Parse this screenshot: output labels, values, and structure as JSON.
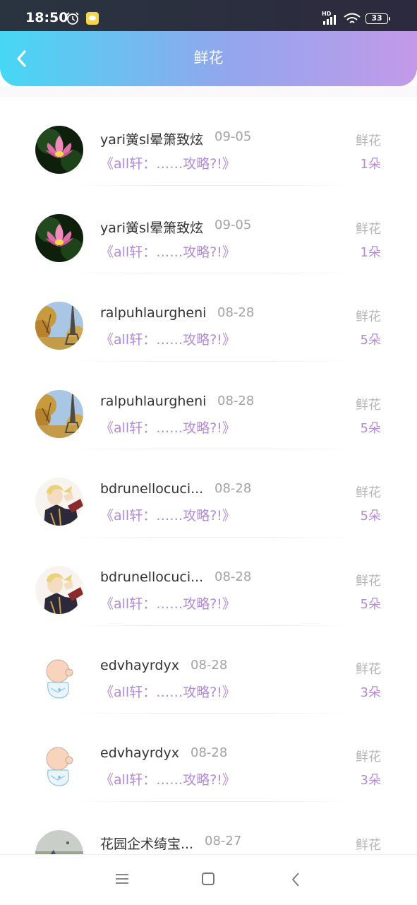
{
  "status_bar": {
    "time": "18:50",
    "hd": "HD",
    "battery": "33"
  },
  "header": {
    "title": "鲜花"
  },
  "colors": {
    "accent": "#b28ad8",
    "gradient_start": "#46d7f5",
    "gradient_end": "#c29ae9"
  },
  "rows": [
    {
      "avatar": "lotus-avatar",
      "name": "yari黉sl晕箫致炫",
      "date": "09-05",
      "subtitle": "《all轩：……攻略?!》",
      "gift_label": "鲜花",
      "gift_count": "1朵"
    },
    {
      "avatar": "lotus-avatar",
      "name": "yari黉sl晕箫致炫",
      "date": "09-05",
      "subtitle": "《all轩：……攻略?!》",
      "gift_label": "鲜花",
      "gift_count": "1朵"
    },
    {
      "avatar": "eiffel-avatar",
      "name": "ralpuhlaurgheni",
      "date": "08-28",
      "subtitle": "《all轩：……攻略?!》",
      "gift_label": "鲜花",
      "gift_count": "5朵"
    },
    {
      "avatar": "eiffel-avatar",
      "name": "ralpuhlaurgheni",
      "date": "08-28",
      "subtitle": "《all轩：……攻略?!》",
      "gift_label": "鲜花",
      "gift_count": "5朵"
    },
    {
      "avatar": "anime-avatar",
      "name": "bdrunellocuci...",
      "date": "08-28",
      "subtitle": "《all轩：……攻略?!》",
      "gift_label": "鲜花",
      "gift_count": "5朵"
    },
    {
      "avatar": "anime-avatar",
      "name": "bdrunellocuci...",
      "date": "08-28",
      "subtitle": "《all轩：……攻略?!》",
      "gift_label": "鲜花",
      "gift_count": "5朵"
    },
    {
      "avatar": "baby-avatar",
      "name": "edvhayrdyx",
      "date": "08-28",
      "subtitle": "《all轩：……攻略?!》",
      "gift_label": "鲜花",
      "gift_count": "3朵"
    },
    {
      "avatar": "baby-avatar",
      "name": "edvhayrdyx",
      "date": "08-28",
      "subtitle": "《all轩：……攻略?!》",
      "gift_label": "鲜花",
      "gift_count": "3朵"
    },
    {
      "avatar": "landscape-avatar",
      "name": "花园企术绮宝...",
      "date": "08-27",
      "subtitle": "",
      "gift_label": "鲜花",
      "gift_count": ""
    }
  ]
}
